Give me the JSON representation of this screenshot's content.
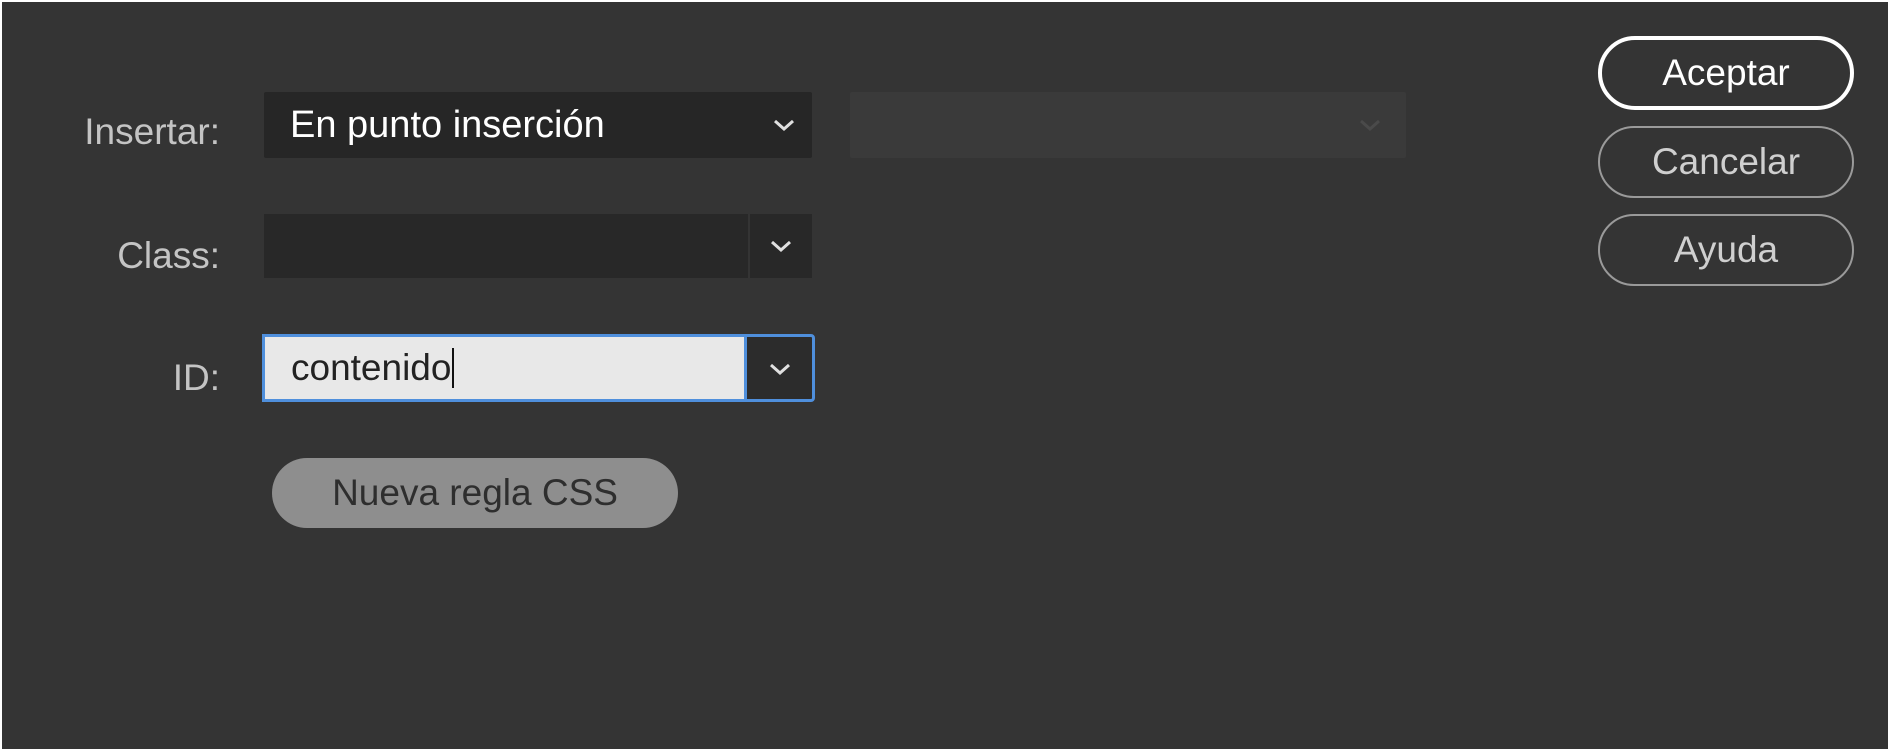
{
  "form": {
    "insert_label": "Insertar:",
    "insert_value": "En punto inserción",
    "insert_secondary_value": "",
    "class_label": "Class:",
    "class_value": "",
    "id_label": "ID:",
    "id_value": "contenido",
    "new_css_rule_label": "Nueva regla CSS"
  },
  "buttons": {
    "ok_label": "Aceptar",
    "cancel_label": "Cancelar",
    "help_label": "Ayuda"
  },
  "icons": {
    "dropdown": "chevron-down-icon"
  },
  "colors": {
    "background": "#343434",
    "field": "#262626",
    "focus_border": "#4f8fdc",
    "id_field_background": "#e8e8e8",
    "secondary_button": "#8e8e8e"
  }
}
